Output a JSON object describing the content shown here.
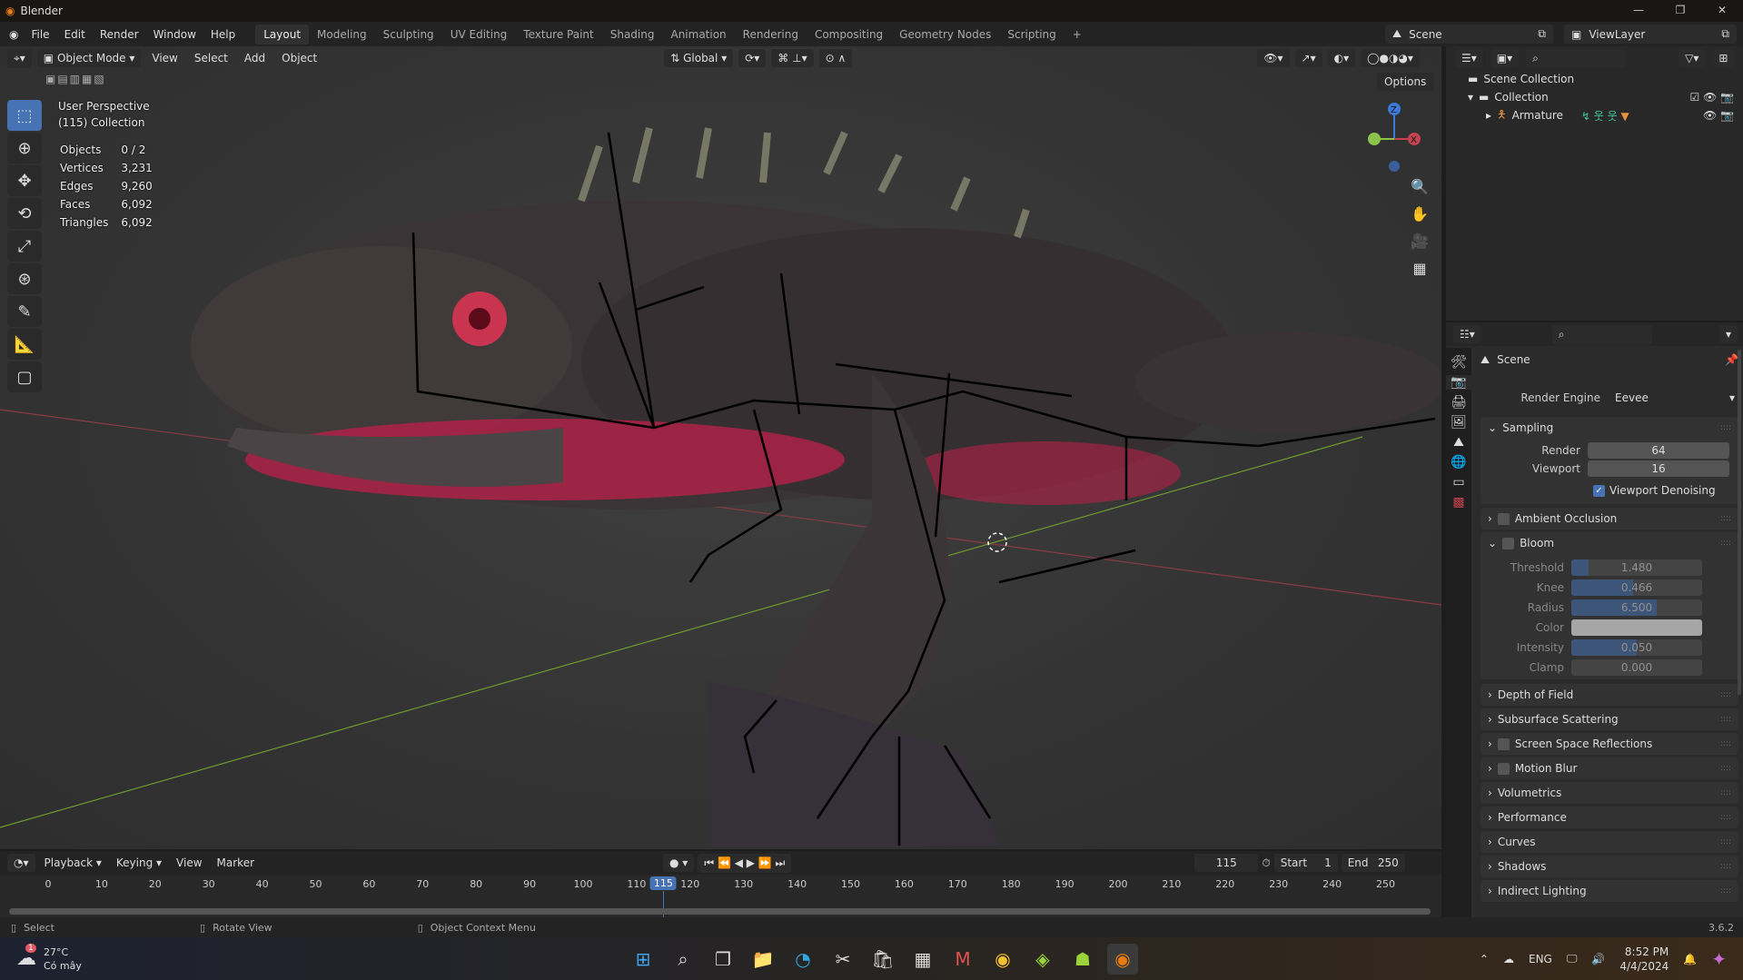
{
  "window": {
    "title": "Blender",
    "controls": [
      "—",
      "❐",
      "✕"
    ]
  },
  "menu": [
    "File",
    "Edit",
    "Render",
    "Window",
    "Help"
  ],
  "workspaces": [
    "Layout",
    "Modeling",
    "Sculpting",
    "UV Editing",
    "Texture Paint",
    "Shading",
    "Animation",
    "Rendering",
    "Compositing",
    "Geometry Nodes",
    "Scripting",
    "+"
  ],
  "active_workspace": "Layout",
  "scene": {
    "name": "Scene",
    "view_layer": "ViewLayer"
  },
  "viewport_header": {
    "mode": "Object Mode",
    "menus": [
      "View",
      "Select",
      "Add",
      "Object"
    ],
    "orientation": "Global",
    "options": "Options"
  },
  "overlay": {
    "perspective": "User Perspective",
    "collection": "(115) Collection",
    "stats": [
      {
        "label": "Objects",
        "value": "0 / 2"
      },
      {
        "label": "Vertices",
        "value": "3,231"
      },
      {
        "label": "Edges",
        "value": "9,260"
      },
      {
        "label": "Faces",
        "value": "6,092"
      },
      {
        "label": "Triangles",
        "value": "6,092"
      }
    ]
  },
  "gizmo": {
    "z": "Z",
    "x": "X"
  },
  "outliner": {
    "items": [
      {
        "label": "Scene Collection"
      },
      {
        "label": "Collection"
      },
      {
        "label": "Armature"
      }
    ]
  },
  "properties": {
    "context": "Scene",
    "render_engine_label": "Render Engine",
    "render_engine": "Eevee",
    "sampling": {
      "title": "Sampling",
      "render_label": "Render",
      "render": "64",
      "viewport_label": "Viewport",
      "viewport": "16",
      "denoise_label": "Viewport Denoising",
      "denoise": true
    },
    "ambient_occlusion": "Ambient Occlusion",
    "bloom": {
      "title": "Bloom",
      "fields": [
        {
          "label": "Threshold",
          "value": "1.480",
          "fraction": 0.13
        },
        {
          "label": "Knee",
          "value": "0.466",
          "fraction": 0.47
        },
        {
          "label": "Radius",
          "value": "6.500",
          "fraction": 0.65
        },
        {
          "label": "Color",
          "value": "",
          "fraction": 0,
          "color": "#b3b3b3"
        },
        {
          "label": "Intensity",
          "value": "0.050",
          "fraction": 0.5
        },
        {
          "label": "Clamp",
          "value": "0.000",
          "fraction": 0
        }
      ]
    },
    "collapsed_panels": [
      {
        "label": "Depth of Field",
        "checkbox": false
      },
      {
        "label": "Subsurface Scattering",
        "checkbox": false
      },
      {
        "label": "Screen Space Reflections",
        "checkbox": true
      },
      {
        "label": "Motion Blur",
        "checkbox": true
      },
      {
        "label": "Volumetrics",
        "checkbox": false
      },
      {
        "label": "Performance",
        "checkbox": false
      },
      {
        "label": "Curves",
        "checkbox": false
      },
      {
        "label": "Shadows",
        "checkbox": false
      },
      {
        "label": "Indirect Lighting",
        "checkbox": false
      }
    ]
  },
  "timeline": {
    "menus": [
      "Playback",
      "Keying",
      "View",
      "Marker"
    ],
    "current_frame": "115",
    "start_label": "Start",
    "start": "1",
    "end_label": "End",
    "end": "250",
    "ticks": [
      "0",
      "10",
      "20",
      "30",
      "40",
      "50",
      "60",
      "70",
      "80",
      "90",
      "100",
      "110",
      "120",
      "130",
      "140",
      "150",
      "160",
      "170",
      "180",
      "190",
      "200",
      "210",
      "220",
      "230",
      "240",
      "250"
    ]
  },
  "status": {
    "select": "Select",
    "rotate": "Rotate View",
    "context_menu": "Object Context Menu",
    "version": "3.6.2"
  },
  "taskbar": {
    "weather_temp": "27°C",
    "weather_desc": "Có mây",
    "weather_badge": "1",
    "lang": "ENG",
    "time": "8:52 PM",
    "date": "4/4/2024"
  },
  "colors": {
    "accent": "#4772b3",
    "x_axis": "#c2424f",
    "y_axis": "#6f9a2e",
    "skin_highlight": "#d2265a"
  }
}
